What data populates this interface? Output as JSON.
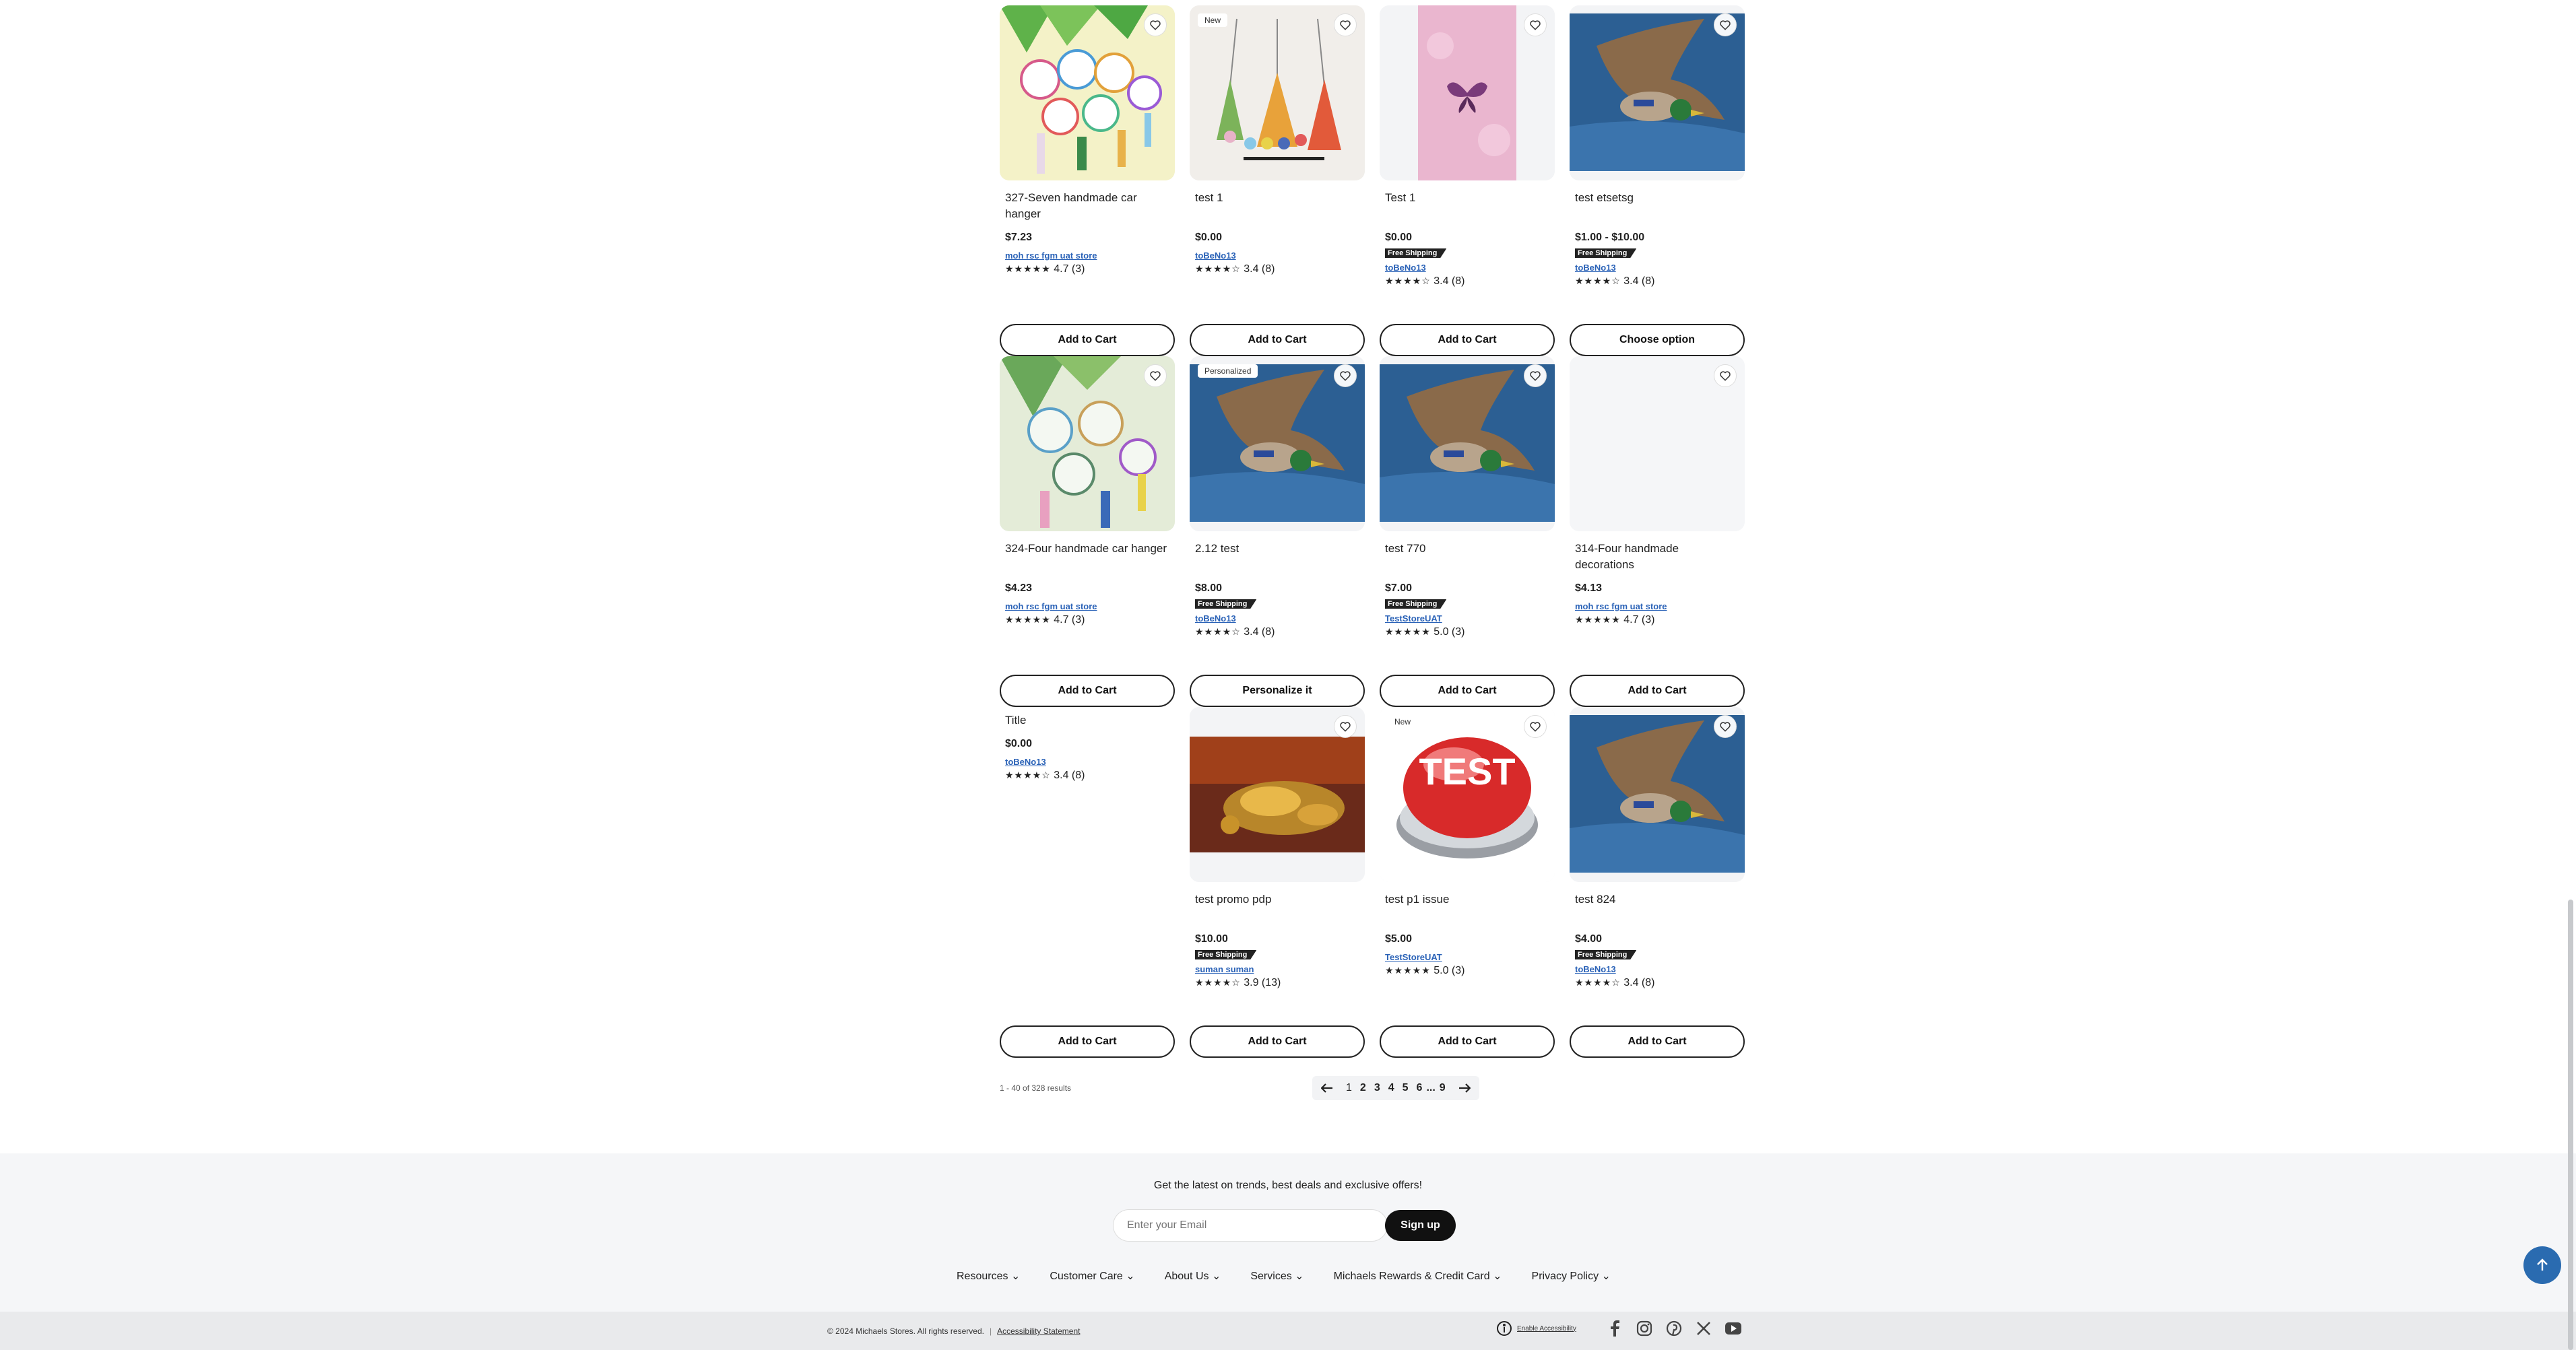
{
  "products": [
    {
      "name": "327-Seven handmade car hanger",
      "price": "$7.23",
      "free_shipping": "",
      "store": "moh rsc fgm uat store",
      "stars": "★★★★★",
      "rating": "4.7",
      "reviews": "(3)",
      "button": "Add to Cart",
      "badge": "",
      "image": "fan-hangers-image"
    },
    {
      "name": "test 1",
      "price": "$0.00",
      "free_shipping": "",
      "store": "toBeNo13",
      "stars": "★★★★☆",
      "rating": "3.4",
      "reviews": "(8)",
      "button": "Add to Cart",
      "badge": "New",
      "image": "ornaments-image"
    },
    {
      "name": "Test 1",
      "price": "$0.00",
      "free_shipping": "Free Shipping",
      "store": "toBeNo13",
      "stars": "★★★★☆",
      "rating": "3.4",
      "reviews": "(8)",
      "button": "Add to Cart",
      "badge": "",
      "image": "butterfly-image"
    },
    {
      "name": "test etsetsg",
      "price": "$1.00 - $10.00",
      "free_shipping": "Free Shipping",
      "store": "toBeNo13",
      "stars": "★★★★☆",
      "rating": "3.4",
      "reviews": "(8)",
      "button": "Choose option",
      "badge": "",
      "image": "duck-image"
    },
    {
      "name": "324-Four handmade car hanger",
      "price": "$4.23",
      "free_shipping": "",
      "store": "moh rsc fgm uat store",
      "stars": "★★★★★",
      "rating": "4.7",
      "reviews": "(3)",
      "button": "Add to Cart",
      "badge": "",
      "image": "fan-hangers-image"
    },
    {
      "name": "2.12 test",
      "price": "$8.00",
      "free_shipping": "Free Shipping",
      "store": "toBeNo13",
      "stars": "★★★★☆",
      "rating": "3.4",
      "reviews": "(8)",
      "button": "Personalize it",
      "badge": "Personalized",
      "image": "duck-image"
    },
    {
      "name": "test 770",
      "price": "$7.00",
      "free_shipping": "Free Shipping",
      "store": "TestStoreUAT",
      "stars": "★★★★★",
      "rating": "5.0",
      "reviews": "(3)",
      "button": "Add to Cart",
      "badge": "",
      "image": "duck-image"
    },
    {
      "name": "314-Four handmade decorations",
      "price": "$4.13",
      "free_shipping": "",
      "store": "moh rsc fgm uat store",
      "stars": "★★★★★",
      "rating": "4.7",
      "reviews": "(3)",
      "button": "Add to Cart",
      "badge": "",
      "image": "placeholder-image"
    },
    {
      "name": "Title",
      "price": "$0.00",
      "free_shipping": "",
      "store": "toBeNo13",
      "stars": "★★★★☆",
      "rating": "3.4",
      "reviews": "(8)",
      "button": "Add to Cart",
      "badge": "",
      "image": "none"
    },
    {
      "name": "test promo pdp",
      "price": "$10.00",
      "free_shipping": "Free Shipping",
      "store": "suman suman",
      "stars": "★★★★☆",
      "rating": "3.9",
      "reviews": "(13)",
      "button": "Add to Cart",
      "badge": "",
      "image": "jewelry-image"
    },
    {
      "name": "test p1 issue",
      "price": "$5.00",
      "free_shipping": "",
      "store": "TestStoreUAT",
      "stars": "★★★★★",
      "rating": "5.0",
      "reviews": "(3)",
      "button": "Add to Cart",
      "badge": "New",
      "image": "test-button-image"
    },
    {
      "name": "test 824",
      "price": "$4.00",
      "free_shipping": "Free Shipping",
      "store": "toBeNo13",
      "stars": "★★★★☆",
      "rating": "3.4",
      "reviews": "(8)",
      "button": "Add to Cart",
      "badge": "",
      "image": "duck-image"
    }
  ],
  "pagination": {
    "results": "1 - 40 of 328 results",
    "pages": [
      "1",
      "2",
      "3",
      "4",
      "5",
      "6",
      "...",
      "9"
    ],
    "current": "1"
  },
  "footer": {
    "newsletter_title": "Get the latest on trends, best deals and exclusive offers!",
    "email_placeholder": "Enter your Email",
    "signup_label": "Sign up",
    "nav": [
      "Resources",
      "Customer Care",
      "About Us",
      "Services",
      "Michaels Rewards & Credit Card",
      "Privacy Policy"
    ],
    "copyright": "© 2024 Michaels Stores. All rights reserved.",
    "accessibility_statement": "Accessibility Statement",
    "enable_accessibility": "Enable Accessibility",
    "social": [
      "facebook-icon",
      "instagram-icon",
      "pinterest-icon",
      "x-icon",
      "youtube-icon"
    ]
  },
  "colors": {
    "accent": "#2a62b7",
    "scroll_top": "#2a6bb0",
    "dark": "#111111"
  }
}
